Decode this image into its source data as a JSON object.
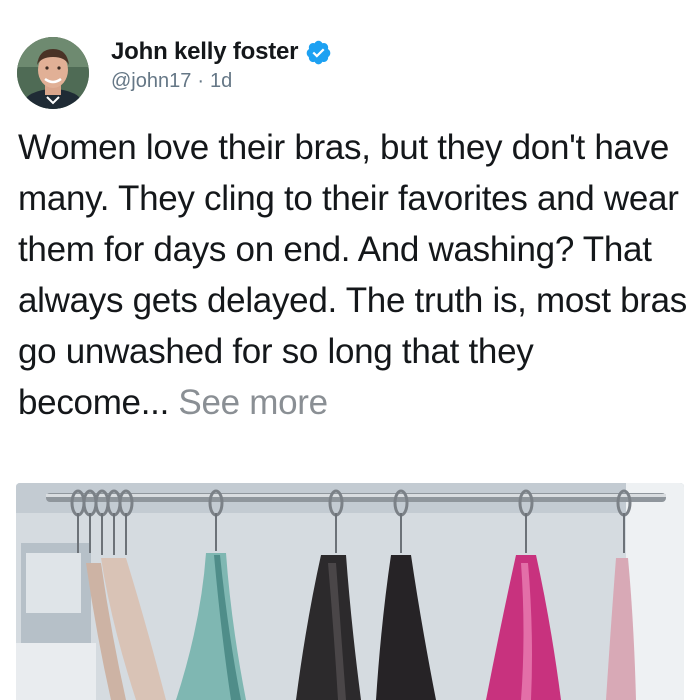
{
  "tweet": {
    "author_name": "John kelly foster",
    "handle": "@john17",
    "separator": "·",
    "time_ago": "1d",
    "text": "Women love their bras, but they don't have many. They cling to their favorites and wear them for days on end. And washing? That always gets delayed. The truth is, most bras go unwashed for so long that they become... ",
    "see_more": "See more"
  },
  "icons": {
    "verified": "verified-badge-icon",
    "avatar": "profile-photo"
  },
  "colors": {
    "name": "#14171a",
    "meta": "#657786",
    "see_more": "#8a8f94",
    "verified": "#1da1f2"
  }
}
